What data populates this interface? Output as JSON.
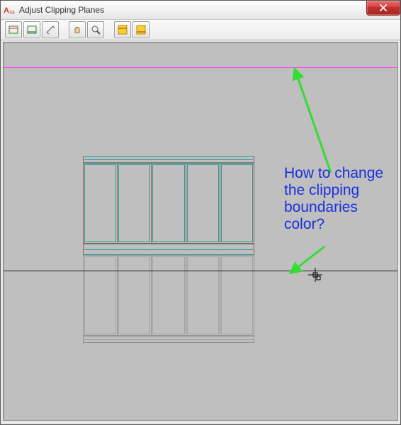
{
  "window": {
    "title": "Adjust Clipping Planes"
  },
  "annotation": {
    "text": "How to change\nthe clipping\nboundaries\ncolor?"
  },
  "clipping": {
    "front_color": "#ff3bf0",
    "back_color": "#202020"
  },
  "toolbar": {
    "buttons": [
      {
        "name": "adjust-front-clip-icon"
      },
      {
        "name": "adjust-back-clip-icon"
      },
      {
        "name": "slice-icon"
      },
      {
        "name": "pan-icon"
      },
      {
        "name": "zoom-icon"
      },
      {
        "name": "front-clip-on-icon"
      },
      {
        "name": "back-clip-on-icon"
      }
    ]
  }
}
